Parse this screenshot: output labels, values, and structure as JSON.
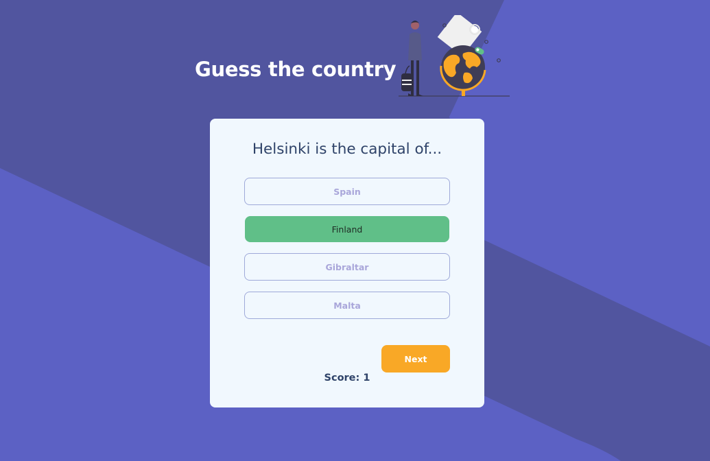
{
  "app": {
    "title": "Guess the country",
    "illustration": "traveler-with-globe-illustration"
  },
  "quiz": {
    "question": "Helsinki is the capital of...",
    "options": [
      {
        "label": "Spain",
        "state": "default"
      },
      {
        "label": "Finland",
        "state": "correct"
      },
      {
        "label": "Gibraltar",
        "state": "default"
      },
      {
        "label": "Malta",
        "state": "default"
      }
    ],
    "next_label": "Next",
    "score_text": "Score: 1"
  },
  "colors": {
    "background": "#5c61c4",
    "background_band": "#51559f",
    "card": "#f1f8fe",
    "correct": "#60bf88",
    "accent": "#f9a826",
    "text_dark": "#2f4369",
    "option_text": "#a9a6da",
    "option_border": "#9ea9d9"
  }
}
